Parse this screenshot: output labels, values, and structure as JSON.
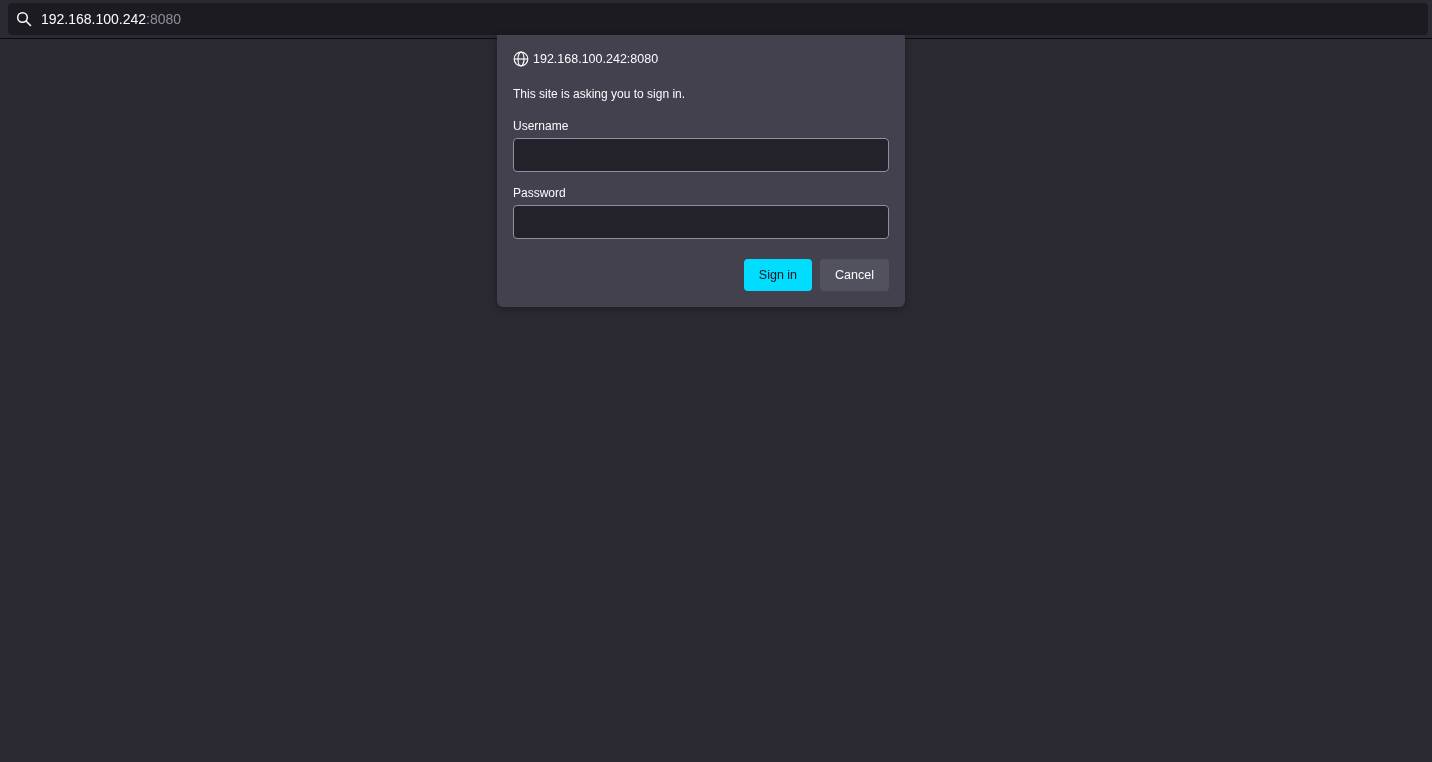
{
  "address_bar": {
    "host": "192.168.100.242",
    "port": ":8080"
  },
  "dialog": {
    "origin": "192.168.100.242:8080",
    "message": "This site is asking you to sign in.",
    "fields": [
      {
        "label": "Username"
      },
      {
        "label": "Password"
      }
    ],
    "buttons": [
      {
        "label": "Sign in",
        "kind": "primary"
      },
      {
        "label": "Cancel",
        "kind": "secondary"
      }
    ]
  }
}
